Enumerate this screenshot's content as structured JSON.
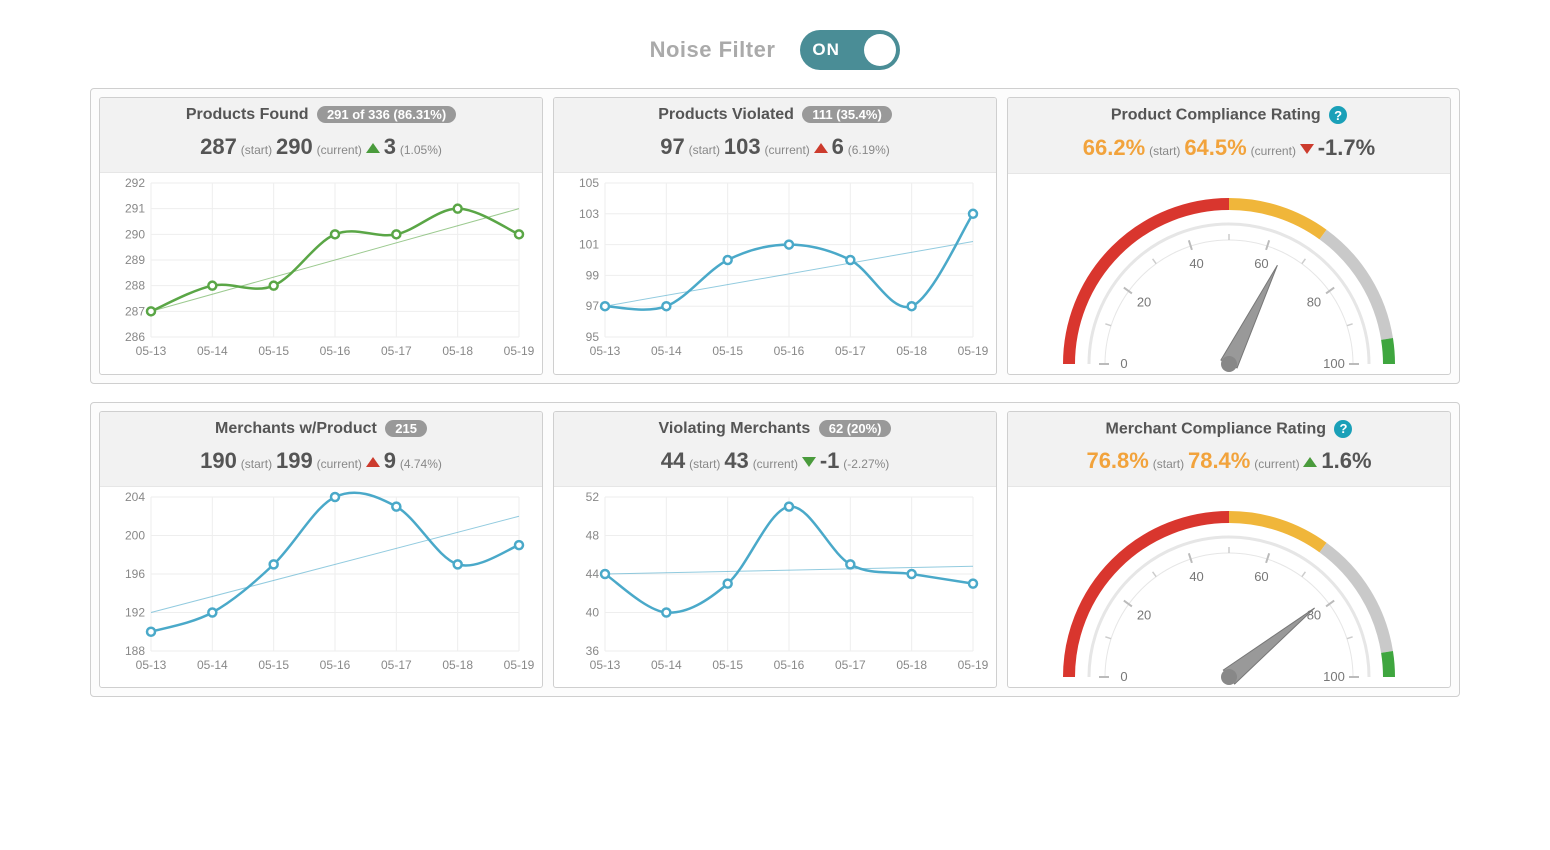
{
  "filter": {
    "label": "Noise Filter",
    "state": "ON"
  },
  "cards": {
    "products_found": {
      "title": "Products Found",
      "badge": "291 of 336 (86.31%)",
      "start": "287",
      "current": "290",
      "delta_dir": "up",
      "delta_color": "green",
      "delta_val": "3",
      "delta_pct": "(1.05%)"
    },
    "products_violated": {
      "title": "Products Violated",
      "badge": "111 (35.4%)",
      "start": "97",
      "current": "103",
      "delta_dir": "up",
      "delta_color": "red",
      "delta_val": "6",
      "delta_pct": "(6.19%)"
    },
    "product_compliance": {
      "title": "Product Compliance Rating",
      "start": "66.2%",
      "current": "64.5%",
      "delta_dir": "down",
      "delta_color": "red",
      "delta_val": "-1.7%"
    },
    "merchants_wproduct": {
      "title": "Merchants w/Product",
      "badge": "215",
      "start": "190",
      "current": "199",
      "delta_dir": "up",
      "delta_color": "red",
      "delta_val": "9",
      "delta_pct": "(4.74%)"
    },
    "violating_merchants": {
      "title": "Violating Merchants",
      "badge": "62 (20%)",
      "start": "44",
      "current": "43",
      "delta_dir": "down",
      "delta_color": "green",
      "delta_val": "-1",
      "delta_pct": "(-2.27%)"
    },
    "merchant_compliance": {
      "title": "Merchant Compliance Rating",
      "start": "76.8%",
      "current": "78.4%",
      "delta_dir": "up",
      "delta_color": "green",
      "delta_val": "1.6%"
    }
  },
  "labels": {
    "start": "(start)",
    "current": "(current)"
  },
  "chart_data": [
    {
      "id": "products_found",
      "type": "line",
      "color": "#5aa646",
      "x": [
        "05-13",
        "05-14",
        "05-15",
        "05-16",
        "05-17",
        "05-18",
        "05-19"
      ],
      "y": [
        287,
        288,
        288,
        290,
        290,
        291,
        290
      ],
      "y_ticks": [
        286,
        287,
        288,
        289,
        290,
        291,
        292
      ],
      "ylim": [
        286,
        292
      ],
      "trend": {
        "y1": 287,
        "y2": 291
      }
    },
    {
      "id": "products_violated",
      "type": "line",
      "color": "#4aa9c9",
      "x": [
        "05-13",
        "05-14",
        "05-15",
        "05-16",
        "05-17",
        "05-18",
        "05-19"
      ],
      "y": [
        97,
        97,
        100,
        101,
        100,
        97,
        103
      ],
      "y_ticks": [
        95,
        97,
        99,
        101,
        103,
        105
      ],
      "ylim": [
        95,
        105
      ],
      "trend": {
        "y1": 97,
        "y2": 101.2
      }
    },
    {
      "id": "product_compliance_gauge",
      "type": "gauge",
      "value": 64.5,
      "min": 0,
      "max": 100,
      "ticks": [
        0,
        20,
        40,
        60,
        80,
        100
      ],
      "bands": [
        {
          "from": 0,
          "to": 50,
          "color": "#d9362e"
        },
        {
          "from": 50,
          "to": 70,
          "color": "#f0b63a"
        },
        {
          "from": 70,
          "to": 95,
          "color": "#c9c9c9"
        },
        {
          "from": 95,
          "to": 100,
          "color": "#3fa63f"
        }
      ]
    },
    {
      "id": "merchants_wproduct",
      "type": "line",
      "color": "#4aa9c9",
      "x": [
        "05-13",
        "05-14",
        "05-15",
        "05-16",
        "05-17",
        "05-18",
        "05-19"
      ],
      "y": [
        190,
        192,
        197,
        204,
        203,
        197,
        199
      ],
      "y_ticks": [
        188,
        192,
        196,
        200,
        204
      ],
      "ylim": [
        188,
        204
      ],
      "trend": {
        "y1": 192,
        "y2": 202
      }
    },
    {
      "id": "violating_merchants",
      "type": "line",
      "color": "#4aa9c9",
      "x": [
        "05-13",
        "05-14",
        "05-15",
        "05-16",
        "05-17",
        "05-18",
        "05-19"
      ],
      "y": [
        44,
        40,
        43,
        51,
        45,
        44,
        43
      ],
      "y_ticks": [
        36,
        40,
        44,
        48,
        52
      ],
      "ylim": [
        36,
        52
      ],
      "trend": {
        "y1": 44,
        "y2": 44.8
      }
    },
    {
      "id": "merchant_compliance_gauge",
      "type": "gauge",
      "value": 78.4,
      "min": 0,
      "max": 100,
      "ticks": [
        0,
        20,
        40,
        60,
        80,
        100
      ],
      "bands": [
        {
          "from": 0,
          "to": 50,
          "color": "#d9362e"
        },
        {
          "from": 50,
          "to": 70,
          "color": "#f0b63a"
        },
        {
          "from": 70,
          "to": 95,
          "color": "#c9c9c9"
        },
        {
          "from": 95,
          "to": 100,
          "color": "#3fa63f"
        }
      ]
    }
  ]
}
